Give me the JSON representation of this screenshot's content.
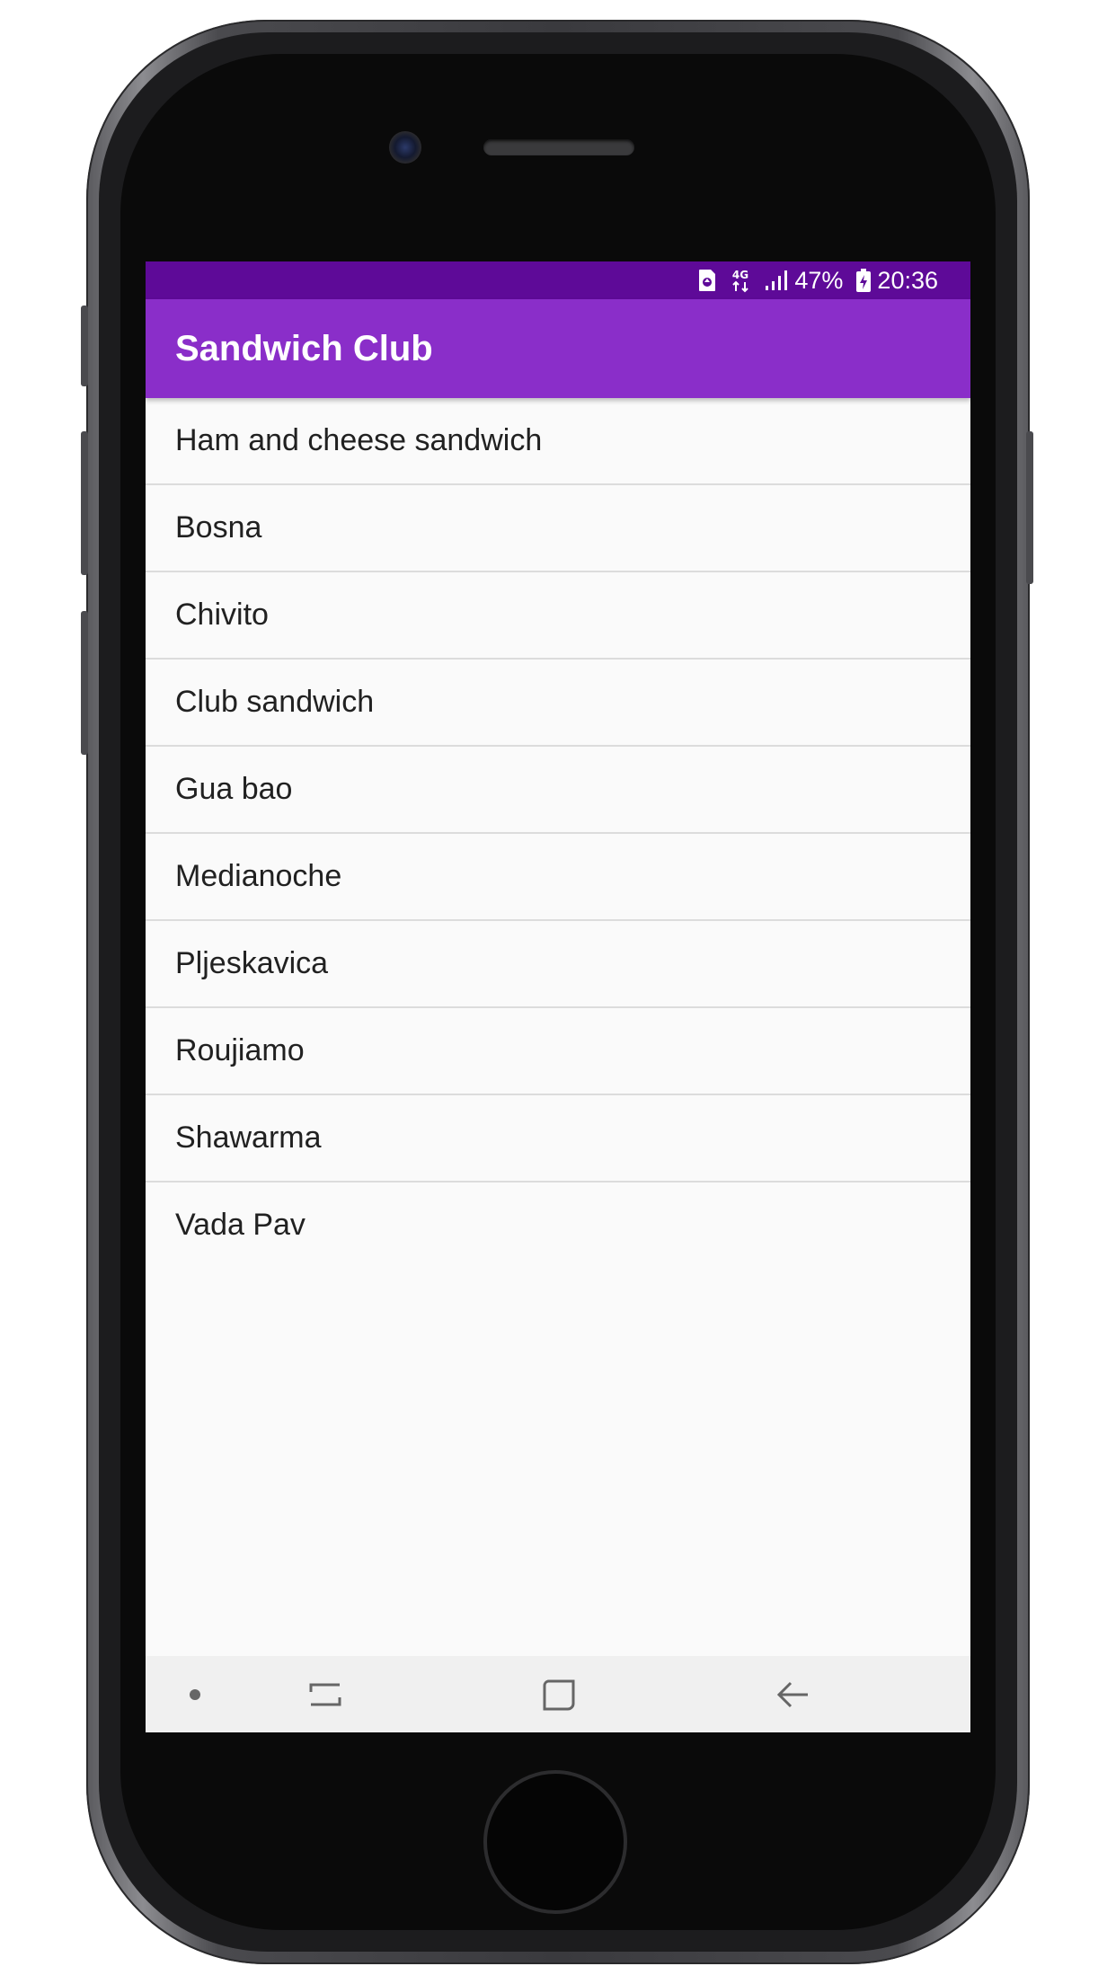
{
  "status_bar": {
    "network": "4G",
    "battery_percent": "47%",
    "time": "20:36",
    "icons": [
      "sim-card-icon",
      "network-4g-icon",
      "signal-icon",
      "battery-icon"
    ]
  },
  "app_bar": {
    "title": "Sandwich Club"
  },
  "sandwich_list": {
    "items": [
      "Ham and cheese sandwich",
      "Bosna",
      "Chivito",
      "Club sandwich",
      "Gua bao",
      "Medianoche",
      "Pljeskavica",
      "Roujiamo",
      "Shawarma",
      "Vada Pav"
    ]
  },
  "nav_bar": {
    "icons": [
      "dot-icon",
      "recent-apps-icon",
      "home-icon",
      "back-icon"
    ]
  },
  "colors": {
    "status_bar": "#5e0a98",
    "primary": "#8a2ec9",
    "background": "#fafafa",
    "text": "#212121",
    "divider": "#dcdcdc"
  }
}
